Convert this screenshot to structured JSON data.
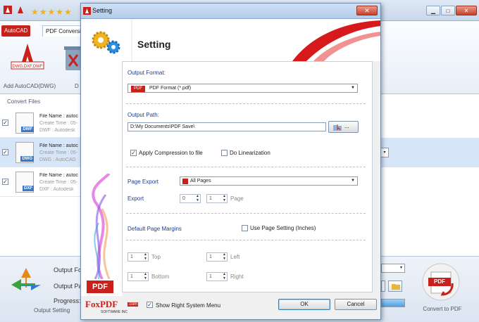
{
  "app": {
    "stars": "★★★★★",
    "ribbon_tab_autocad": "AutoCAD",
    "ribbon_tab_pdf": "PDF Conversion",
    "add_autocad_label": "Add AutoCAD(DWG)",
    "delete_label_partial": "D",
    "convert_files_header": "Convert Files",
    "files": [
      {
        "name": "File Name : autoc",
        "time": "Create Time : 05-",
        "type": "DWF : Autodesk",
        "ext": "DWF",
        "color": "#3c78c3",
        "checked": true
      },
      {
        "name": "File Name : autoc",
        "time": "Create Time : 05-",
        "type": "DWG : AutoCAD",
        "ext": "DWG",
        "color": "#3c78c3",
        "checked": true
      },
      {
        "name": "File Name : autoc",
        "time": "Create Time : 05-",
        "type": "DXF : Autodesk",
        "ext": "DXF",
        "color": "#3c78c3",
        "checked": true
      }
    ],
    "output_format_label": "Output Fo",
    "output_path_label": "Output Pa",
    "progress_label": "Progress:",
    "output_setting_label": "Output Setting",
    "convert_to_pdf_label": "Convert to PDF",
    "convert_icon_text": "PDF"
  },
  "dialog": {
    "title": "Setting",
    "header_title": "Setting",
    "close_label": "✕",
    "output_format_label": "Output Format:",
    "output_format_badge": "PDF",
    "output_format_value": "PDF Format (*.pdf)",
    "output_path_label": "Output Path:",
    "output_path_value": "D:\\My Documents\\PDF Save\\",
    "browse_label": "...",
    "apply_compression_label": "Apply Compression to file",
    "apply_compression_checked": true,
    "do_linearization_label": "Do Linearization",
    "do_linearization_checked": false,
    "page_export_label": "Page Export",
    "page_export_value": "All Pages",
    "export_label": "Export",
    "export_from": "0",
    "export_to": "1",
    "page_label": "Page",
    "default_margins_label": "Default Page Margins",
    "use_page_setting_label": "Use Page Setting (Inches)",
    "use_page_setting_checked": false,
    "margin_top": "1",
    "margin_top_label": "Top",
    "margin_left": "1",
    "margin_left_label": "Left",
    "margin_bottom": "1",
    "margin_bottom_label": "Bottom",
    "margin_right": "1",
    "margin_right_label": "Right",
    "show_right_menu_label": "Show Right System Menu",
    "show_right_menu_checked": true,
    "ok_label": "OK",
    "cancel_label": "Cancel",
    "side_pdf_label": "PDF",
    "logo_text": "FoxPDF",
    "logo_sub": "SOFTWARE INC",
    "logo_com": ".com"
  }
}
